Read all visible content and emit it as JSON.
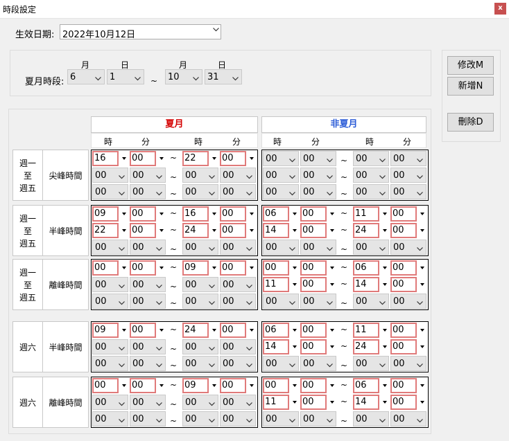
{
  "window": {
    "title": "時段設定",
    "close": "x"
  },
  "effective": {
    "label": "生效日期:",
    "value": "2022年10月12日"
  },
  "summer_period": {
    "label": "夏月時段:",
    "month_label": "月",
    "day_label": "日",
    "start_month": "6",
    "start_day": "1",
    "end_month": "10",
    "end_day": "31",
    "tilde": "~"
  },
  "buttons": {
    "modify": "修改M",
    "add": "新增N",
    "delete": "刪除D"
  },
  "headers": {
    "summer": "夏月",
    "nonsummer": "非夏月",
    "hour": "時",
    "minute": "分",
    "summer_color": "#d40000",
    "nonsummer_color": "#2a5bd7"
  },
  "tilde": "~",
  "row_groups": [
    {
      "day": [
        "週一",
        "至",
        "週五"
      ],
      "category": "尖峰時間",
      "summer": [
        [
          "16",
          "00",
          "22",
          "00"
        ],
        [
          "00",
          "00",
          "00",
          "00"
        ],
        [
          "00",
          "00",
          "00",
          "00"
        ]
      ],
      "summer_active": [
        true,
        false,
        false
      ],
      "nonsummer": [
        [
          "00",
          "00",
          "00",
          "00"
        ],
        [
          "00",
          "00",
          "00",
          "00"
        ],
        [
          "00",
          "00",
          "00",
          "00"
        ]
      ],
      "nonsummer_active": [
        false,
        false,
        false
      ]
    },
    {
      "day": [
        "週一",
        "至",
        "週五"
      ],
      "category": "半峰時間",
      "summer": [
        [
          "09",
          "00",
          "16",
          "00"
        ],
        [
          "22",
          "00",
          "24",
          "00"
        ],
        [
          "00",
          "00",
          "00",
          "00"
        ]
      ],
      "summer_active": [
        true,
        true,
        false
      ],
      "nonsummer": [
        [
          "06",
          "00",
          "11",
          "00"
        ],
        [
          "14",
          "00",
          "24",
          "00"
        ],
        [
          "00",
          "00",
          "00",
          "00"
        ]
      ],
      "nonsummer_active": [
        true,
        true,
        false
      ]
    },
    {
      "day": [
        "週一",
        "至",
        "週五"
      ],
      "category": "離峰時間",
      "summer": [
        [
          "00",
          "00",
          "09",
          "00"
        ],
        [
          "00",
          "00",
          "00",
          "00"
        ],
        [
          "00",
          "00",
          "00",
          "00"
        ]
      ],
      "summer_active": [
        true,
        false,
        false
      ],
      "nonsummer": [
        [
          "00",
          "00",
          "06",
          "00"
        ],
        [
          "11",
          "00",
          "14",
          "00"
        ],
        [
          "00",
          "00",
          "00",
          "00"
        ]
      ],
      "nonsummer_active": [
        true,
        true,
        false
      ]
    },
    {
      "day": [
        "週六"
      ],
      "category": "半峰時間",
      "summer": [
        [
          "09",
          "00",
          "24",
          "00"
        ],
        [
          "00",
          "00",
          "00",
          "00"
        ],
        [
          "00",
          "00",
          "00",
          "00"
        ]
      ],
      "summer_active": [
        true,
        false,
        false
      ],
      "nonsummer": [
        [
          "06",
          "00",
          "11",
          "00"
        ],
        [
          "14",
          "00",
          "24",
          "00"
        ],
        [
          "00",
          "00",
          "00",
          "00"
        ]
      ],
      "nonsummer_active": [
        true,
        true,
        false
      ]
    },
    {
      "day": [
        "週六"
      ],
      "category": "離峰時間",
      "summer": [
        [
          "00",
          "00",
          "09",
          "00"
        ],
        [
          "00",
          "00",
          "00",
          "00"
        ],
        [
          "00",
          "00",
          "00",
          "00"
        ]
      ],
      "summer_active": [
        true,
        false,
        false
      ],
      "nonsummer": [
        [
          "00",
          "00",
          "06",
          "00"
        ],
        [
          "11",
          "00",
          "14",
          "00"
        ],
        [
          "00",
          "00",
          "00",
          "00"
        ]
      ],
      "nonsummer_active": [
        true,
        true,
        false
      ]
    }
  ]
}
